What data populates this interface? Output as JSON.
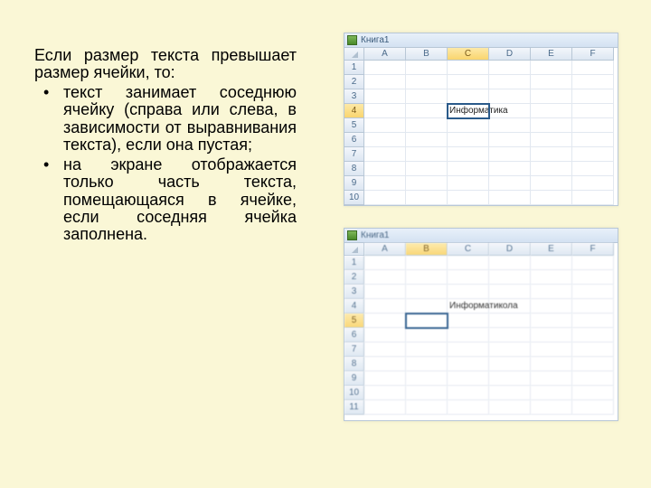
{
  "text": {
    "intro": "Если размер текста превышает размер ячейки, то:",
    "bullet1": "текст занимает соседнюю ячейку (справа или слева, в зависимости от выравнивания текста), если она пустая;",
    "bullet2": "на экране отображается только часть текста, помещающаяся в ячейке, если соседняя ячейка заполнена."
  },
  "sheet1": {
    "title": "Книга1",
    "cols": [
      "A",
      "B",
      "C",
      "D",
      "E",
      "F"
    ],
    "rows": [
      "1",
      "2",
      "3",
      "4",
      "5",
      "6",
      "7",
      "8",
      "9",
      "10"
    ],
    "selected_col": "C",
    "selected_row": "4",
    "content_cell": "Информатика"
  },
  "sheet2": {
    "title": "Книга1",
    "cols": [
      "A",
      "B",
      "C",
      "D",
      "E",
      "F"
    ],
    "rows": [
      "1",
      "2",
      "3",
      "4",
      "5",
      "6",
      "7",
      "8",
      "9",
      "10",
      "11"
    ],
    "selected_col": "B",
    "selected_row": "5",
    "content_cell": "Информатикола"
  }
}
